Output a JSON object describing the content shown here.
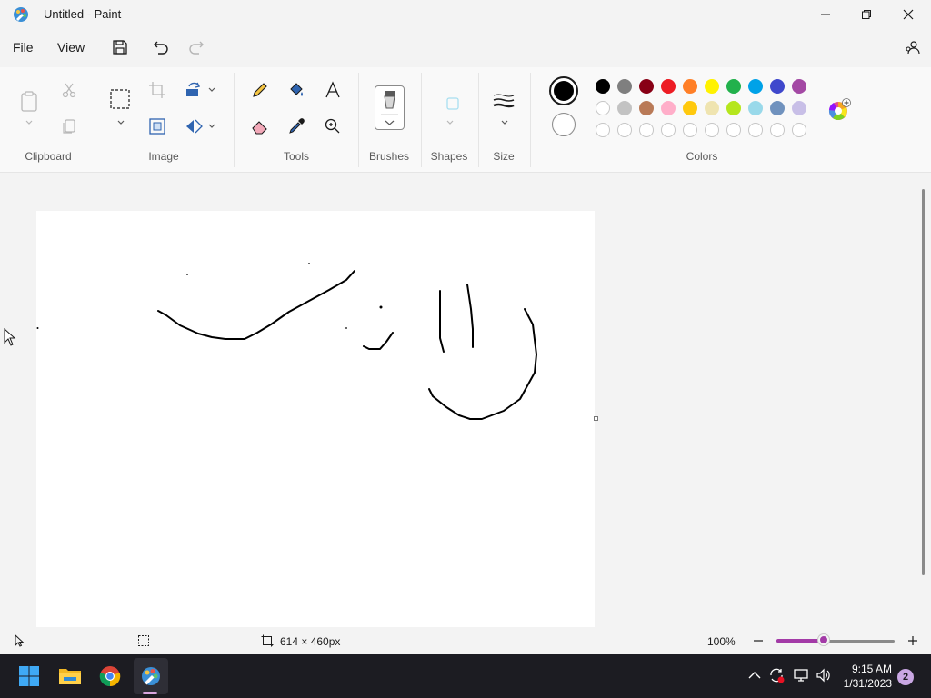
{
  "window": {
    "title": "Untitled - Paint"
  },
  "menu": {
    "file": "File",
    "view": "View"
  },
  "ribbon": {
    "groups": {
      "clipboard": "Clipboard",
      "image": "Image",
      "tools": "Tools",
      "brushes": "Brushes",
      "shapes": "Shapes",
      "size": "Size",
      "colors": "Colors"
    },
    "primary_color": "#000000",
    "secondary_color": "#ffffff",
    "palette_row1": [
      "#000000",
      "#7f7f7f",
      "#880015",
      "#ed1c24",
      "#ff7f27",
      "#fff200",
      "#22b14c",
      "#00a2e8",
      "#3f48cc",
      "#a349a4"
    ],
    "palette_row2": [
      "#ffffff",
      "#c3c3c3",
      "#b97a57",
      "#ffaec9",
      "#ffc90e",
      "#efe4b0",
      "#b5e61d",
      "#99d9ea",
      "#7092be",
      "#c8bfe7"
    ],
    "palette_row3_count_label": ""
  },
  "status": {
    "canvas_size": "614 × 460px",
    "zoom": "100%",
    "zoom_level": 0.4
  },
  "taskbar": {
    "time": "9:15 AM",
    "date": "1/31/2023",
    "notifications": "2"
  },
  "colors": {
    "accent": "#a33aa7",
    "canvas": "#ffffff",
    "taskbar": "#1c1c22"
  }
}
